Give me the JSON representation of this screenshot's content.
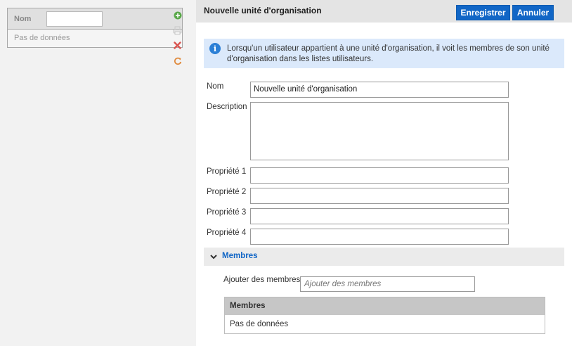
{
  "left": {
    "list": {
      "column_header": "Nom",
      "empty_text": "Pas de données"
    },
    "tools": {
      "add_icon": "add-circle-icon",
      "print_icon": "print-icon",
      "delete_icon": "delete-x-icon",
      "refresh_icon": "refresh-icon"
    }
  },
  "header": {
    "title": "Nouvelle unité d'organisation",
    "save_label": "Enregistrer",
    "cancel_label": "Annuler"
  },
  "info": {
    "icon": "i",
    "text": "Lorsqu'un utilisateur appartient à une unité d'organisation, il voit les membres de son unité d'organisation dans les listes utilisateurs."
  },
  "form": {
    "name_label": "Nom",
    "name_value": "Nouvelle unité d'organisation",
    "description_label": "Description",
    "description_value": "",
    "prop1_label": "Propriété 1",
    "prop2_label": "Propriété 2",
    "prop3_label": "Propriété 3",
    "prop4_label": "Propriété 4"
  },
  "members": {
    "section_title": "Membres",
    "add_label": "Ajouter des membres",
    "add_placeholder": "Ajouter des membres",
    "table_header": "Membres",
    "empty_text": "Pas de données"
  },
  "colors": {
    "accent": "#1166c6",
    "info_bg": "#dbe9fb",
    "add_green": "#5aa84a",
    "delete_red": "#d9534f",
    "refresh_orange": "#e08a3c"
  }
}
